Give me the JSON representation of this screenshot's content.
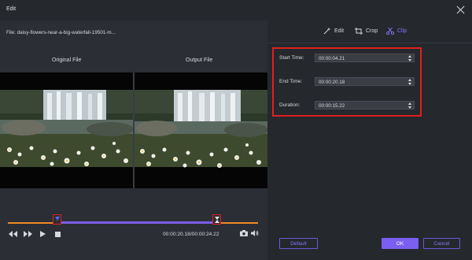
{
  "window": {
    "title": "Edit"
  },
  "file": {
    "label": "File: daisy-flowers-near-a-big-waterfall-19501-m..."
  },
  "panes": {
    "original_title": "Original File",
    "output_title": "Output File"
  },
  "playback": {
    "timecode": "00:00:20.18/00:00:24.22",
    "clip_start_fraction": 0.198,
    "clip_end_fraction": 0.837
  },
  "tabs": [
    {
      "label": "Edit",
      "icon": "magic-wand-icon",
      "active": false
    },
    {
      "label": "Crop",
      "icon": "crop-icon",
      "active": false
    },
    {
      "label": "Clip",
      "icon": "scissors-icon",
      "active": true
    }
  ],
  "clip": {
    "start_label": "Start Time:",
    "start_value": "00:00:04.21",
    "end_label": "End Time:",
    "end_value": "00:00:20.18",
    "duration_label": "Duration:",
    "duration_value": "00:00:15.22"
  },
  "buttons": {
    "default": "Default",
    "ok": "OK",
    "cancel": "Cancel"
  },
  "colors": {
    "accent": "#7a5ff0",
    "highlight_box": "#e0201f",
    "timeline_base": "#f08a24"
  }
}
